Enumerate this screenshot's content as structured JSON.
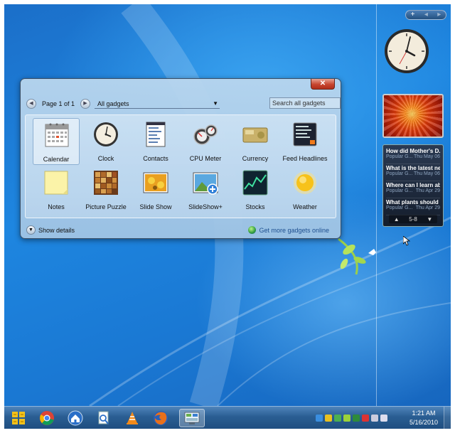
{
  "window": {
    "pager_label": "Page 1 of 1",
    "filter_value": "All gadgets",
    "search_placeholder": "Search all gadgets",
    "close_symbol": "✕",
    "show_details": "Show details",
    "more_online": "Get more gadgets online"
  },
  "gadgets": [
    {
      "name": "Calendar",
      "icon": "calendar-icon"
    },
    {
      "name": "Clock",
      "icon": "clock-icon"
    },
    {
      "name": "Contacts",
      "icon": "contacts-icon"
    },
    {
      "name": "CPU Meter",
      "icon": "cpu-meter-icon"
    },
    {
      "name": "Currency",
      "icon": "currency-icon"
    },
    {
      "name": "Feed Headlines",
      "icon": "feed-headlines-icon"
    },
    {
      "name": "Notes",
      "icon": "notes-icon"
    },
    {
      "name": "Picture Puzzle",
      "icon": "picture-puzzle-icon"
    },
    {
      "name": "Slide Show",
      "icon": "slide-show-icon"
    },
    {
      "name": "SlideShow+",
      "icon": "slideshow-plus-icon"
    },
    {
      "name": "Stocks",
      "icon": "stocks-icon"
    },
    {
      "name": "Weather",
      "icon": "weather-icon"
    }
  ],
  "sidebar": {
    "add_symbol": "+",
    "feed": {
      "items": [
        {
          "title": "How did Mother's D...",
          "source": "Popular G...",
          "date": "Thu May 06"
        },
        {
          "title": "What is the latest ne...",
          "source": "Popular G...",
          "date": "Thu May 06"
        },
        {
          "title": "Where can I learn ab...",
          "source": "Popular G...",
          "date": "Thu Apr 29"
        },
        {
          "title": "What plants should I...",
          "source": "Popular G...",
          "date": "Thu Apr 29"
        }
      ],
      "range": "5-8"
    }
  },
  "taskbar": {
    "time": "1:21 AM",
    "date": "5/16/2010",
    "apps": [
      "windows-live-icon",
      "chrome-icon",
      "home-icon",
      "search-doc-icon",
      "vlc-icon",
      "firefox-icon",
      "gadgets-icon"
    ],
    "active_app": "gadgets-icon"
  },
  "colors": {
    "desktop": "#1e86e0",
    "taskbar": "#2a5e93",
    "link": "#1e4f8f",
    "close": "#c7452f"
  }
}
